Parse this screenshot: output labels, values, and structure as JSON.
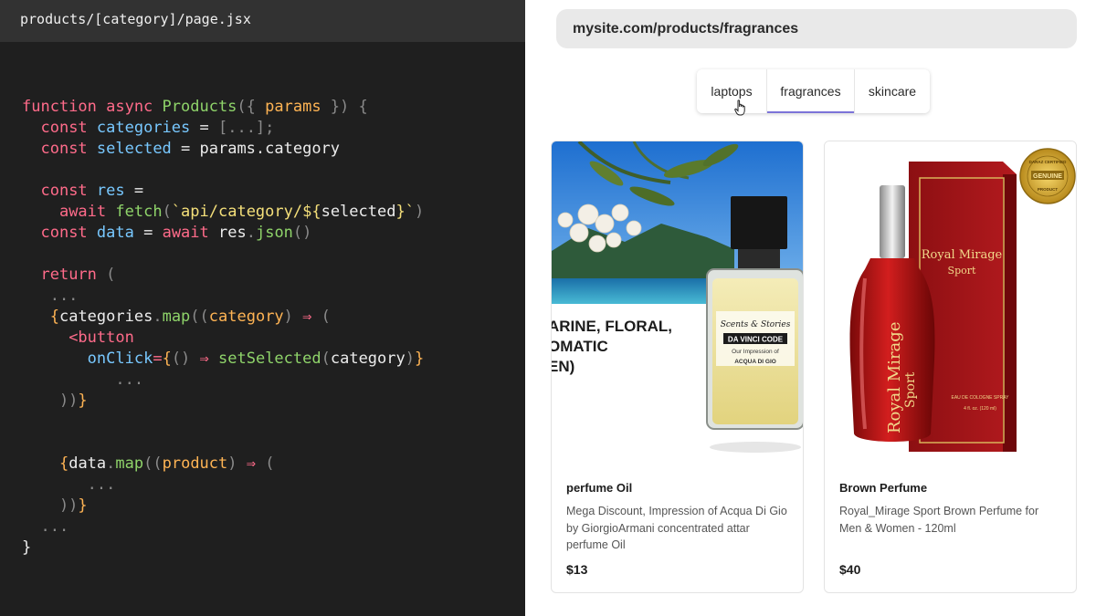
{
  "editor": {
    "file_name": "products/[category]/page.jsx",
    "code_lines": [
      [
        [
          "kw",
          "function async "
        ],
        [
          "fn",
          "Products"
        ],
        [
          "pn",
          "({ "
        ],
        [
          "pm",
          "params"
        ],
        [
          "pn",
          " }) {"
        ]
      ],
      [
        [
          "tx",
          "  "
        ],
        [
          "kw",
          "const "
        ],
        [
          "vr",
          "categories"
        ],
        [
          "tx",
          " = "
        ],
        [
          "pn",
          "[...];"
        ]
      ],
      [
        [
          "tx",
          "  "
        ],
        [
          "kw",
          "const "
        ],
        [
          "vr",
          "selected"
        ],
        [
          "tx",
          " = params.category"
        ]
      ],
      [],
      [
        [
          "tx",
          "  "
        ],
        [
          "kw",
          "const "
        ],
        [
          "vr",
          "res"
        ],
        [
          "tx",
          " ="
        ]
      ],
      [
        [
          "tx",
          "    "
        ],
        [
          "kw",
          "await "
        ],
        [
          "fn",
          "fetch"
        ],
        [
          "pn",
          "("
        ],
        [
          "str",
          "`api/category/${"
        ],
        [
          "tx",
          "selected"
        ],
        [
          "str",
          "}`"
        ],
        [
          "pn",
          ")"
        ]
      ],
      [
        [
          "tx",
          "  "
        ],
        [
          "kw",
          "const "
        ],
        [
          "vr",
          "data"
        ],
        [
          "tx",
          " = "
        ],
        [
          "kw",
          "await "
        ],
        [
          "tx",
          "res"
        ],
        [
          "pn",
          "."
        ],
        [
          "fn",
          "json"
        ],
        [
          "pn",
          "()"
        ]
      ],
      [],
      [
        [
          "tx",
          "  "
        ],
        [
          "kw",
          "return "
        ],
        [
          "pn",
          "("
        ]
      ],
      [
        [
          "pn",
          "   ..."
        ]
      ],
      [
        [
          "tx",
          "   "
        ],
        [
          "pm",
          "{"
        ],
        [
          "tx",
          "categories"
        ],
        [
          "pn",
          "."
        ],
        [
          "fn",
          "map"
        ],
        [
          "pn",
          "(("
        ],
        [
          "pm",
          "category"
        ],
        [
          "pn",
          ") "
        ],
        [
          "kw",
          "⇒"
        ],
        [
          "pn",
          " ("
        ]
      ],
      [
        [
          "tx",
          "     "
        ],
        [
          "kw",
          "<button"
        ]
      ],
      [
        [
          "tx",
          "       "
        ],
        [
          "vr",
          "onClick"
        ],
        [
          "kw",
          "="
        ],
        [
          "pm",
          "{"
        ],
        [
          "pn",
          "() "
        ],
        [
          "kw",
          "⇒ "
        ],
        [
          "fn",
          "setSelected"
        ],
        [
          "pn",
          "("
        ],
        [
          "tx",
          "category"
        ],
        [
          "pn",
          ")"
        ],
        [
          "pm",
          "}"
        ]
      ],
      [
        [
          "pn",
          "          ..."
        ]
      ],
      [
        [
          "pn",
          "    ))"
        ],
        [
          "pm",
          "}"
        ]
      ],
      [],
      [],
      [
        [
          "tx",
          "    "
        ],
        [
          "pm",
          "{"
        ],
        [
          "tx",
          "data"
        ],
        [
          "pn",
          "."
        ],
        [
          "fn",
          "map"
        ],
        [
          "pn",
          "(("
        ],
        [
          "pm",
          "product"
        ],
        [
          "pn",
          ") "
        ],
        [
          "kw",
          "⇒"
        ],
        [
          "pn",
          " ("
        ]
      ],
      [
        [
          "pn",
          "       ..."
        ]
      ],
      [
        [
          "pn",
          "    ))"
        ],
        [
          "pm",
          "}"
        ]
      ],
      [
        [
          "pn",
          "  ..."
        ]
      ],
      [
        [
          "tx",
          "}"
        ]
      ]
    ]
  },
  "browser": {
    "url": "mysite.com/products/fragrances",
    "tabs": [
      "laptops",
      "fragrances",
      "skincare"
    ],
    "selected_tab": "fragrances",
    "products": [
      {
        "title": "perfume Oil",
        "description": "Mega Discount, Impression of Acqua Di Gio by GiorgioArmani concentrated attar perfume Oil",
        "price": "$13",
        "image_text": {
          "line1": "ARINE, FLORAL,",
          "line2": "OMATIC",
          "line3": "EN)",
          "brand": "Scents & Stories",
          "name": "DA VINCI CODE",
          "sub": "Our Impression of",
          "impression": "ACQUA DI GIO"
        }
      },
      {
        "title": "Brown Perfume",
        "description": "Royal_Mirage Sport Brown Perfume for Men & Women - 120ml",
        "price": "$40",
        "image_text": {
          "box_brand": "Royal Mirage",
          "box_sub": "Sport",
          "bottle_brand": "Royal Mirage",
          "bottle_sub": "Sport",
          "box_type": "EAU DE COLOGNE SPRAY",
          "volume": "4 fl. oz. (120 ml)",
          "seal_top": "DARAZ CERTIFIED",
          "seal_mid": "GENUINE",
          "seal_bot": "PRODUCT"
        }
      }
    ]
  },
  "colors": {
    "editor_bg": "#1f1f1f",
    "keyword": "#ff6b8a",
    "function": "#8fd46a",
    "variable": "#78c8ff",
    "string": "#f5e07a",
    "param": "#ffb454",
    "tab_accent": "#7c73d8"
  }
}
